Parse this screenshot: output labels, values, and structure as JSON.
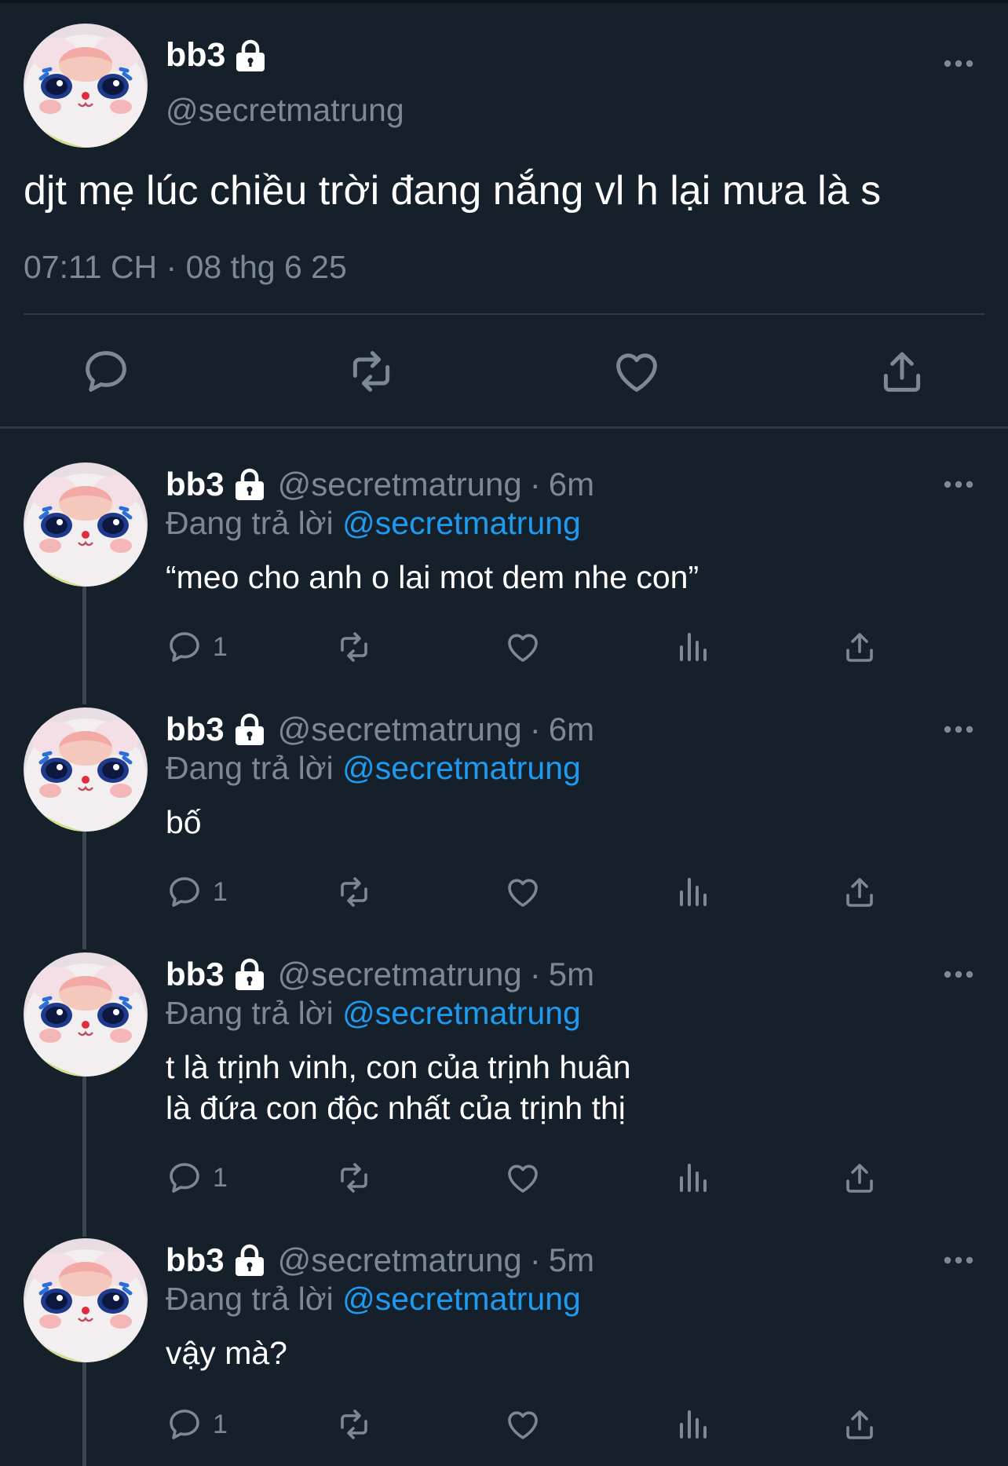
{
  "main_tweet": {
    "display_name": "bb3",
    "handle": "@secretmatrung",
    "text": "djt mẹ lúc chiều trời đang nắng vl h lại mưa là s",
    "timestamp": "07:11 CH · 08 thg 6 25",
    "icons": [
      "lock-icon",
      "more-icon",
      "reply-icon",
      "retweet-icon",
      "like-icon",
      "share-icon"
    ]
  },
  "replies": [
    {
      "display_name": "bb3",
      "handle": "@secretmatrung",
      "dot": "·",
      "time": "6m",
      "replying_prefix": "Đang trả lời",
      "replying_to": "@secretmatrung",
      "text": "“meo cho anh o lai mot dem nhe con”",
      "reply_count": "1"
    },
    {
      "display_name": "bb3",
      "handle": "@secretmatrung",
      "dot": "·",
      "time": "6m",
      "replying_prefix": "Đang trả lời",
      "replying_to": "@secretmatrung",
      "text": "bố",
      "reply_count": "1"
    },
    {
      "display_name": "bb3",
      "handle": "@secretmatrung",
      "dot": "·",
      "time": "5m",
      "replying_prefix": "Đang trả lời",
      "replying_to": "@secretmatrung",
      "text_lines": [
        "t là trịnh vinh, con của trịnh huân",
        "là đứa con độc nhất của trịnh thị"
      ],
      "reply_count": "1"
    },
    {
      "display_name": "bb3",
      "handle": "@secretmatrung",
      "dot": "·",
      "time": "5m",
      "replying_prefix": "Đang trả lời",
      "replying_to": "@secretmatrung",
      "text": "vậy mà?",
      "reply_count": "1"
    }
  ],
  "colors": {
    "background": "#16202b",
    "muted": "#7c8896",
    "accent": "#1d9bf0",
    "divider": "#2c3844"
  }
}
